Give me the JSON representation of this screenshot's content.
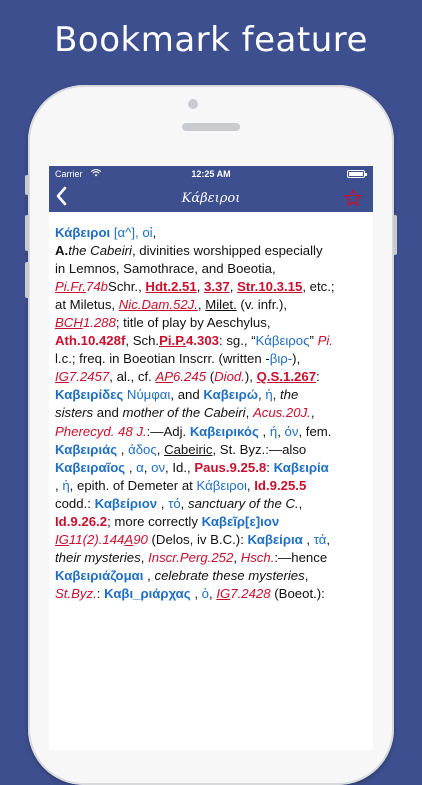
{
  "headline": "Bookmark feature",
  "status_bar": {
    "carrier": "Carrier",
    "time": "12:25 AM"
  },
  "nav": {
    "title": "Κάβειροι",
    "back_icon": "chevron-left-icon",
    "bookmark_icon": "star-outline-icon"
  },
  "colors": {
    "nav_bg": "#3d4f8f",
    "headword": "#1e6fc4",
    "reference": "#c8102e",
    "bookmark_star": "#c8102e"
  },
  "entry": {
    "lines": [
      [
        {
          "t": "Κάβειροι",
          "c": "hw"
        },
        {
          "t": " [α^], ",
          "c": "gk"
        },
        {
          "t": "οἱ",
          "c": "gk"
        },
        {
          "t": ","
        }
      ],
      [
        {
          "t": "A.",
          "c": "b"
        },
        {
          "t": "the Cabeiri",
          "c": "it"
        },
        {
          "t": ", divinities worshipped especially"
        }
      ],
      [
        {
          "t": "in Lemnos, Samothrace, and Boeotia,"
        }
      ],
      [
        {
          "t": "Pi.",
          "c": "rd it ul"
        },
        {
          "t": "Fr.",
          "c": "rd it ul"
        },
        {
          "t": "74b",
          "c": "rd it"
        },
        {
          "t": "Schr., "
        },
        {
          "t": "Hdt.2.51",
          "c": "rdb ul"
        },
        {
          "t": ", "
        },
        {
          "t": "3.37",
          "c": "rdb ul"
        },
        {
          "t": ", "
        },
        {
          "t": "Str.10.3.15",
          "c": "rdb ul"
        },
        {
          "t": ", etc.;"
        }
      ],
      [
        {
          "t": "at Miletus, "
        },
        {
          "t": "Nic.Dam.52J.",
          "c": "rd it ul"
        },
        {
          "t": ", "
        },
        {
          "t": "Milet.",
          "c": "ul"
        },
        {
          "t": " (v. infr.),"
        }
      ],
      [
        {
          "t": "BCH",
          "c": "rd it ul"
        },
        {
          "t": "1.288",
          "c": "rd it"
        },
        {
          "t": "; title of play by Aeschylus,"
        }
      ],
      [
        {
          "t": "Ath.10.428f",
          "c": "rdb"
        },
        {
          "t": ", Sch."
        },
        {
          "t": "Pi.",
          "c": "rdb ul"
        },
        {
          "t": "P.",
          "c": "rdb ul"
        },
        {
          "t": "4.303",
          "c": "rdb"
        },
        {
          "t": ": sg., “"
        },
        {
          "t": "Κάβειρος",
          "c": "gk"
        },
        {
          "t": "” "
        },
        {
          "t": "Pi.",
          "c": "rd it"
        }
      ],
      [
        {
          "t": "l.c.; freq. in Boeotian Inscrr. (written -"
        },
        {
          "t": "βιρ-",
          "c": "gk"
        },
        {
          "t": "),"
        }
      ],
      [
        {
          "t": "IG",
          "c": "rd it ul"
        },
        {
          "t": "7.2457",
          "c": "rd it"
        },
        {
          "t": ", al., cf. "
        },
        {
          "t": "AP",
          "c": "rd it ul"
        },
        {
          "t": "6.245",
          "c": "rd it"
        },
        {
          "t": " ("
        },
        {
          "t": "Diod.",
          "c": "rd it"
        },
        {
          "t": "), "
        },
        {
          "t": "Q.S.1.267",
          "c": "rdb ul"
        },
        {
          "t": ":"
        }
      ],
      [
        {
          "t": "Καβειρίδες",
          "c": "hw"
        },
        {
          "t": " "
        },
        {
          "t": "Νύμφαι",
          "c": "gk"
        },
        {
          "t": ", and "
        },
        {
          "t": "Καβειρώ",
          "c": "hw"
        },
        {
          "t": ", "
        },
        {
          "t": "ἡ",
          "c": "gk"
        },
        {
          "t": ", "
        },
        {
          "t": "the",
          "c": "it"
        }
      ],
      [
        {
          "t": "sisters",
          "c": "it"
        },
        {
          "t": " and "
        },
        {
          "t": "mother of the Cabeiri",
          "c": "it"
        },
        {
          "t": ", "
        },
        {
          "t": "Acus.20J.",
          "c": "rd it"
        },
        {
          "t": ","
        }
      ],
      [
        {
          "t": "Pherecyd. 48 J.",
          "c": "rd it"
        },
        {
          "t": ":—Adj. "
        },
        {
          "t": "Καβειρικός",
          "c": "hw"
        },
        {
          "t": " , "
        },
        {
          "t": "ή",
          "c": "gk"
        },
        {
          "t": ", "
        },
        {
          "t": "όν",
          "c": "gk"
        },
        {
          "t": ", fem."
        }
      ],
      [
        {
          "t": "Καβειριάς",
          "c": "hw"
        },
        {
          "t": " , "
        },
        {
          "t": "άδος",
          "c": "gk"
        },
        {
          "t": ", "
        },
        {
          "t": "Cabeiric",
          "c": "ul"
        },
        {
          "t": ", St. Byz.:—also"
        }
      ],
      [
        {
          "t": "Καβειραῖος",
          "c": "hw"
        },
        {
          "t": " , "
        },
        {
          "t": "α",
          "c": "gk"
        },
        {
          "t": ", "
        },
        {
          "t": "ον",
          "c": "gk"
        },
        {
          "t": ", Id., "
        },
        {
          "t": "Paus.9.25.8",
          "c": "rdb"
        },
        {
          "t": ": "
        },
        {
          "t": "Καβειρία",
          "c": "hw"
        }
      ],
      [
        {
          "t": ", "
        },
        {
          "t": "ἡ",
          "c": "gk"
        },
        {
          "t": ", epith. of Demeter at "
        },
        {
          "t": "Κάβειροι",
          "c": "gk"
        },
        {
          "t": ", "
        },
        {
          "t": "Id.9.25.5",
          "c": "rdb"
        }
      ],
      [
        {
          "t": "codd.: "
        },
        {
          "t": "Καβείριον",
          "c": "hw"
        },
        {
          "t": " , "
        },
        {
          "t": "τό",
          "c": "gk"
        },
        {
          "t": ", "
        },
        {
          "t": "sanctuary of the C.",
          "c": "it"
        },
        {
          "t": ","
        }
      ],
      [
        {
          "t": "Id.9.26.2",
          "c": "rdb"
        },
        {
          "t": "; more correctly "
        },
        {
          "t": "Καβεῖρ[ε]ιον",
          "c": "hw"
        }
      ],
      [
        {
          "t": "IG",
          "c": "rd it ul"
        },
        {
          "t": "11(2).144",
          "c": "rd it"
        },
        {
          "t": "A",
          "c": "rd it ul"
        },
        {
          "t": "90",
          "c": "rd it"
        },
        {
          "t": " (Delos, iv B.C.): "
        },
        {
          "t": "Καβείρια",
          "c": "hw"
        },
        {
          "t": " , "
        },
        {
          "t": "τά",
          "c": "gk"
        },
        {
          "t": ","
        }
      ],
      [
        {
          "t": "their mysteries",
          "c": "it"
        },
        {
          "t": ", "
        },
        {
          "t": "Inscr.Perg.252",
          "c": "rd it"
        },
        {
          "t": ", "
        },
        {
          "t": "Hsch.",
          "c": "rd it"
        },
        {
          "t": ":—hence"
        }
      ],
      [
        {
          "t": "Καβειριάζομαι",
          "c": "hw"
        },
        {
          "t": " , "
        },
        {
          "t": "celebrate these mysteries",
          "c": "it"
        },
        {
          "t": ","
        }
      ],
      [
        {
          "t": "St.Byz.",
          "c": "rd it"
        },
        {
          "t": ": "
        },
        {
          "t": "Καβι_ριάρχας",
          "c": "hw"
        },
        {
          "t": " , "
        },
        {
          "t": "ὁ",
          "c": "gk"
        },
        {
          "t": ", "
        },
        {
          "t": "IG",
          "c": "rd it ul"
        },
        {
          "t": "7.2428",
          "c": "rd it"
        },
        {
          "t": " (Boeot.):"
        }
      ]
    ]
  }
}
